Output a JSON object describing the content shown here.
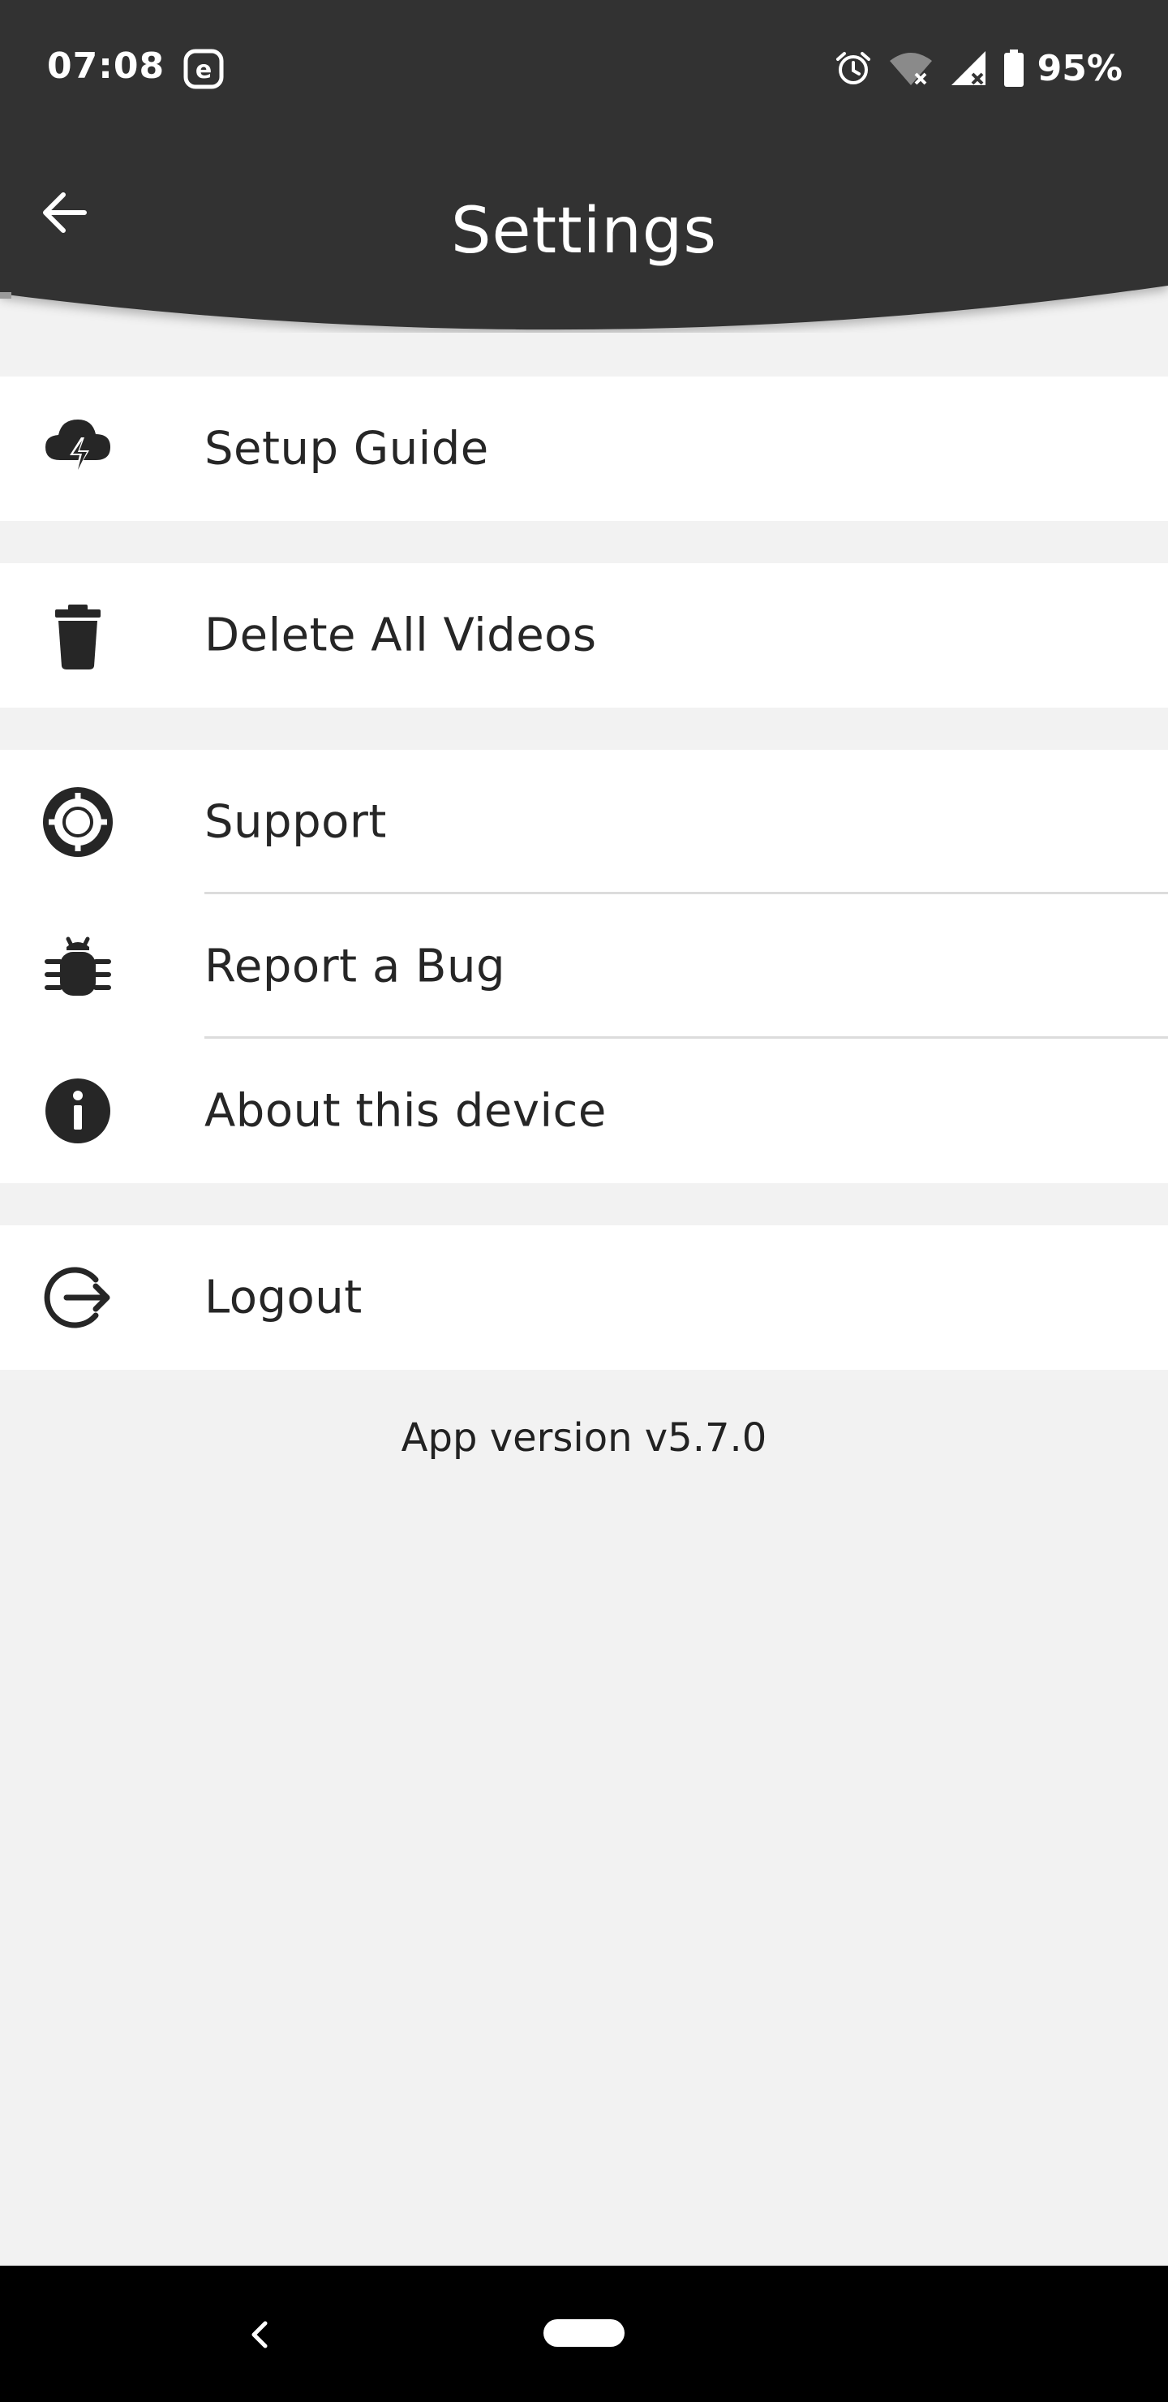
{
  "status_bar": {
    "time": "07:08",
    "app_notification_icon": "e-circle-icon",
    "icons": [
      "alarm-icon",
      "wifi-off-icon",
      "signal-off-icon",
      "battery-icon"
    ],
    "battery_percent": "95%"
  },
  "header": {
    "title": "Settings",
    "background_color": "#333333",
    "back_icon": "arrow-left-icon"
  },
  "sections": [
    {
      "items": [
        {
          "label": "Setup Guide",
          "icon": "cloud-lightning-icon"
        }
      ]
    },
    {
      "items": [
        {
          "label": "Delete All Videos",
          "icon": "trash-icon"
        }
      ]
    },
    {
      "items": [
        {
          "label": "Support",
          "icon": "lifebuoy-icon"
        },
        {
          "label": "Report a Bug",
          "icon": "bug-icon"
        },
        {
          "label": "About this device",
          "icon": "info-icon"
        }
      ]
    },
    {
      "items": [
        {
          "label": "Logout",
          "icon": "logout-icon"
        }
      ]
    }
  ],
  "footer": {
    "app_version": "App version v5.7.0"
  },
  "nav_bar": {
    "back_icon": "chevron-left-icon",
    "home_icon": "home-pill-icon"
  },
  "colors": {
    "header": "#333333",
    "background": "#f2f2f2",
    "row_background": "#ffffff",
    "icon": "#262626"
  }
}
